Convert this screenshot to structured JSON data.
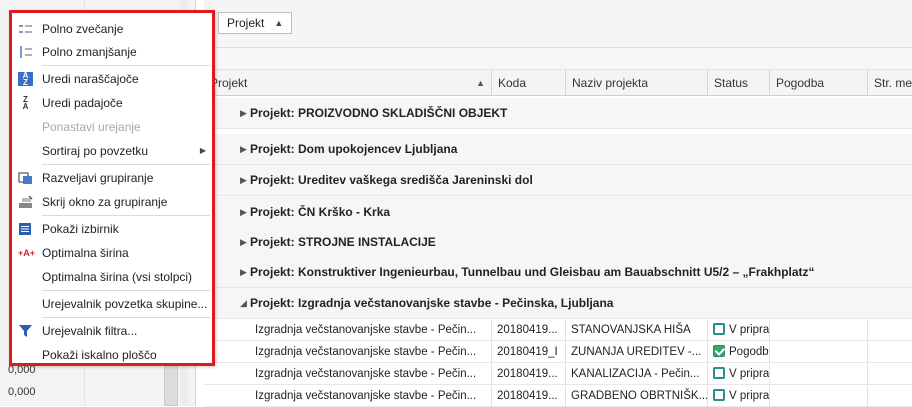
{
  "left_panel": {
    "values": [
      "0,000",
      "0,000"
    ]
  },
  "group_bar": {
    "chip_label": "Projekt"
  },
  "columns": [
    "Projekt",
    "Koda",
    "Naziv projekta",
    "Status",
    "Pogodba",
    "Str. mes"
  ],
  "groups": [
    "Projekt: PROIZVODNO SKLADIŠČNI OBJEKT",
    "Projekt: Dom upokojencev Ljubljana",
    "Projekt: Ureditev vaškega središča Jareninski dol",
    "Projekt: ČN Krško - Krka",
    "Projekt: STROJNE INSTALACIJE",
    "Projekt: Konstruktiver Ingenieurbau, Tunnelbau und Gleisbau am Bauabschnitt U5/2 – „Frakhplatz“",
    "Projekt: Izgradnja večstanovanjske stavbe - Pečinska, Ljubljana"
  ],
  "rows": [
    {
      "projekt": "Izgradnja večstanovanjske stavbe - Pečin...",
      "koda": "20180419...",
      "naziv": "STANOVANJSKA HIŠA",
      "status": "V priprav",
      "status_kind": "open"
    },
    {
      "projekt": "Izgradnja večstanovanjske stavbe - Pečin...",
      "koda": "20180419_I",
      "naziv": "ZUNANJA UREDITEV -...",
      "status": "Pogodb",
      "status_kind": "ok"
    },
    {
      "projekt": "Izgradnja večstanovanjske stavbe - Pečin...",
      "koda": "20180419...",
      "naziv": "KANALIZACIJA - Pečin...",
      "status": "V priprav",
      "status_kind": "open"
    },
    {
      "projekt": "Izgradnja večstanovanjske stavbe - Pečin...",
      "koda": "20180419...",
      "naziv": "GRADBENO OBRTNIŠK...",
      "status": "V priprav",
      "status_kind": "open"
    }
  ],
  "menu": {
    "items": [
      {
        "label": "Polno zvečanje",
        "icon": "expand-all-icon"
      },
      {
        "label": "Polno zmanjšanje",
        "icon": "collapse-all-icon"
      },
      {
        "label": "Uredi naraščajoče",
        "icon": "sort-ascending-icon"
      },
      {
        "label": "Uredi padajoče",
        "icon": "sort-descending-icon"
      },
      {
        "label": "Ponastavi urejanje",
        "icon": "",
        "disabled": true
      },
      {
        "label": "Sortiraj po povzetku",
        "icon": "",
        "submenu": true
      },
      {
        "label": "Razveljavi grupiranje",
        "icon": "ungroup-icon"
      },
      {
        "label": "Skrij okno za grupiranje",
        "icon": "hide-group-panel-icon"
      },
      {
        "label": "Pokaži izbirnik",
        "icon": "column-chooser-icon"
      },
      {
        "label": "Optimalna širina",
        "icon": "best-fit-icon"
      },
      {
        "label": "Optimalna širina (vsi stolpci)",
        "icon": ""
      },
      {
        "label": "Urejevalnik povzetka skupine...",
        "icon": ""
      },
      {
        "label": "Urejevalnik filtra...",
        "icon": "filter-icon"
      },
      {
        "label": "Pokaži iskalno ploščo",
        "icon": ""
      }
    ]
  }
}
